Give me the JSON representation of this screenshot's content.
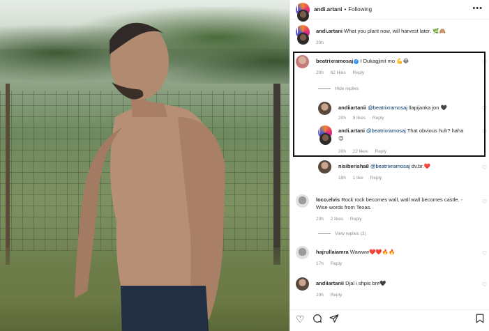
{
  "header": {
    "username": "andi.artani",
    "separator": "•",
    "following_label": "Following",
    "more_icon": "more-horizontal-icon"
  },
  "caption": {
    "username": "andi.artani",
    "text": "What you plant now, will harvest later. 🌿🙈",
    "time": "20h"
  },
  "comments": [
    {
      "username": "beatrixramosaj",
      "verified": true,
      "text": "I Dukagjinit mo 💪😂",
      "time": "20h",
      "likes": "62 likes",
      "reply": "Reply"
    },
    {
      "hide_replies": "Hide replies"
    },
    {
      "username": "andiiartanii",
      "mention": "@beatrixramosaj",
      "text": "llapijanka jon 🖤",
      "time": "20h",
      "likes": "9 likes",
      "reply": "Reply"
    },
    {
      "username": "andi.artani",
      "mention": "@beatrixramosaj",
      "text": "That obvious huh? haha 😊",
      "time": "20h",
      "likes": "22 likes",
      "reply": "Reply"
    },
    {
      "username": "nisiberisha8",
      "mention": "@beatrixramosaj",
      "text": "dv.br.❤️",
      "time": "18h",
      "likes": "1 like",
      "reply": "Reply"
    },
    {
      "username": "loco.elvis",
      "text": "Rock rock becomes wall, wall wall becomes castle. -Wise words from Texas.",
      "time": "20h",
      "likes": "2 likes",
      "reply": "Reply",
      "view_replies": "View replies (3)"
    },
    {
      "username": "hajrullaiamra",
      "text": "Wawww❤️❤️🔥🔥",
      "time": "17h",
      "reply": "Reply"
    },
    {
      "username": "andiiartanii",
      "text": "Djal i shpis bre🖤",
      "time": "20h",
      "reply": "Reply"
    }
  ],
  "actions": {
    "like_icon": "heart-icon",
    "comment_icon": "comment-icon",
    "share_icon": "send-icon",
    "save_icon": "bookmark-icon"
  },
  "colors": {
    "highlight_box": "#111111",
    "mention": "#00376b",
    "meta": "#8e8e8e",
    "verified": "#3897f0"
  }
}
